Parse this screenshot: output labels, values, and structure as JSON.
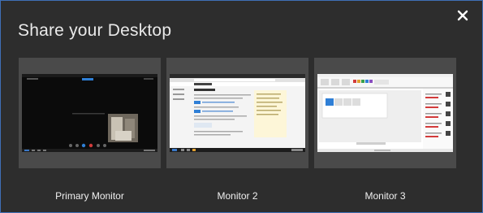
{
  "dialog": {
    "title": "Share your Desktop",
    "close_icon": "close-icon"
  },
  "monitors": [
    {
      "label": "Primary Monitor",
      "preview": "dark-video-call-screen"
    },
    {
      "label": "Monitor 2",
      "preview": "browser-web-page"
    },
    {
      "label": "Monitor 3",
      "preview": "office-application-window"
    }
  ],
  "colors": {
    "background": "#2d2d2d",
    "tile": "#4a4a4a",
    "border": "#3f6fb6",
    "accent": "#2f7fd6"
  }
}
